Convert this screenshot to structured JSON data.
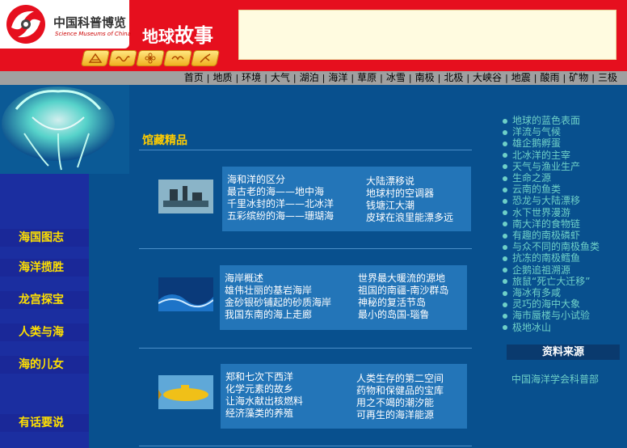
{
  "header": {
    "logo_cn": "中国科普博览",
    "logo_en": "Science Museums of China",
    "title_a": "地球",
    "title_b": "故事",
    "category_icons": [
      "weather-icon",
      "wave-icon",
      "flower-icon",
      "bird-icon",
      "branch-icon"
    ]
  },
  "nav": [
    "首页",
    "地质",
    "环境",
    "大气",
    "湖泊",
    "海洋",
    "草原",
    "冰雪",
    "南极",
    "北极",
    "大峡谷",
    "地震",
    "酸雨",
    "矿物",
    "三极"
  ],
  "sidebar": [
    "海国图志",
    "海洋揽胜",
    "龙宫探宝",
    "人类与海",
    "海的儿女",
    "有话要说"
  ],
  "main": {
    "title": "馆藏精品",
    "panels": [
      {
        "left": [
          "海和洋的区分",
          "最古老的海——地中海",
          "千里冰封的洋——北冰洋",
          "五彩缤纷的海——珊瑚海"
        ],
        "right": [
          "大陆漂移说",
          "地球村的空调器",
          "钱塘江大潮",
          "皮球在浪里能漂多远"
        ]
      },
      {
        "left": [
          "海岸概述",
          "雄伟壮丽的基岩海岸",
          "金砂银砂铺起的砂质海岸",
          "我国东南的海上走廊"
        ],
        "right": [
          "世界最大暖流的源地",
          "祖国的南疆-南沙群岛",
          "神秘的复活节岛",
          "最小的岛国-瑙鲁"
        ]
      },
      {
        "left": [
          "郑和七次下西洋",
          "化学元素的故乡",
          "让海水献出核燃料",
          "经济藻类的养殖"
        ],
        "right": [
          "人类生存的第二空间",
          "药物和保健品的宝库",
          "用之不竭的潮汐能",
          "可再生的海洋能源"
        ]
      }
    ]
  },
  "right_links": [
    "地球的蓝色表面",
    "洋流与气候",
    "雄企鹅孵蛋",
    "北冰洋的主宰",
    "天气与渔业生产",
    "生命之源",
    "云南的鱼类",
    "恐龙与大陆漂移",
    "水下世界漫游",
    "南大洋的食物链",
    "有趣的南极磷虾",
    "与众不同的南极鱼类",
    "抗冻的南极鳕鱼",
    "企鹅追祖溯源",
    "旅鼠“死亡大迁移”",
    "海冰有多咸",
    "灵巧的海中大象",
    "海市蜃楼与小试验",
    "极地冰山"
  ],
  "source": {
    "heading": "资料来源",
    "link": "中国海洋学会科普部"
  },
  "colors": {
    "header_red": "#e60f1e",
    "page_blue": "#08508e",
    "sidebar_blue": "#1b2ea0",
    "sidebar_text": "#ffe000",
    "link_teal": "#6ed0c8",
    "title_gold": "#ffcc00"
  }
}
